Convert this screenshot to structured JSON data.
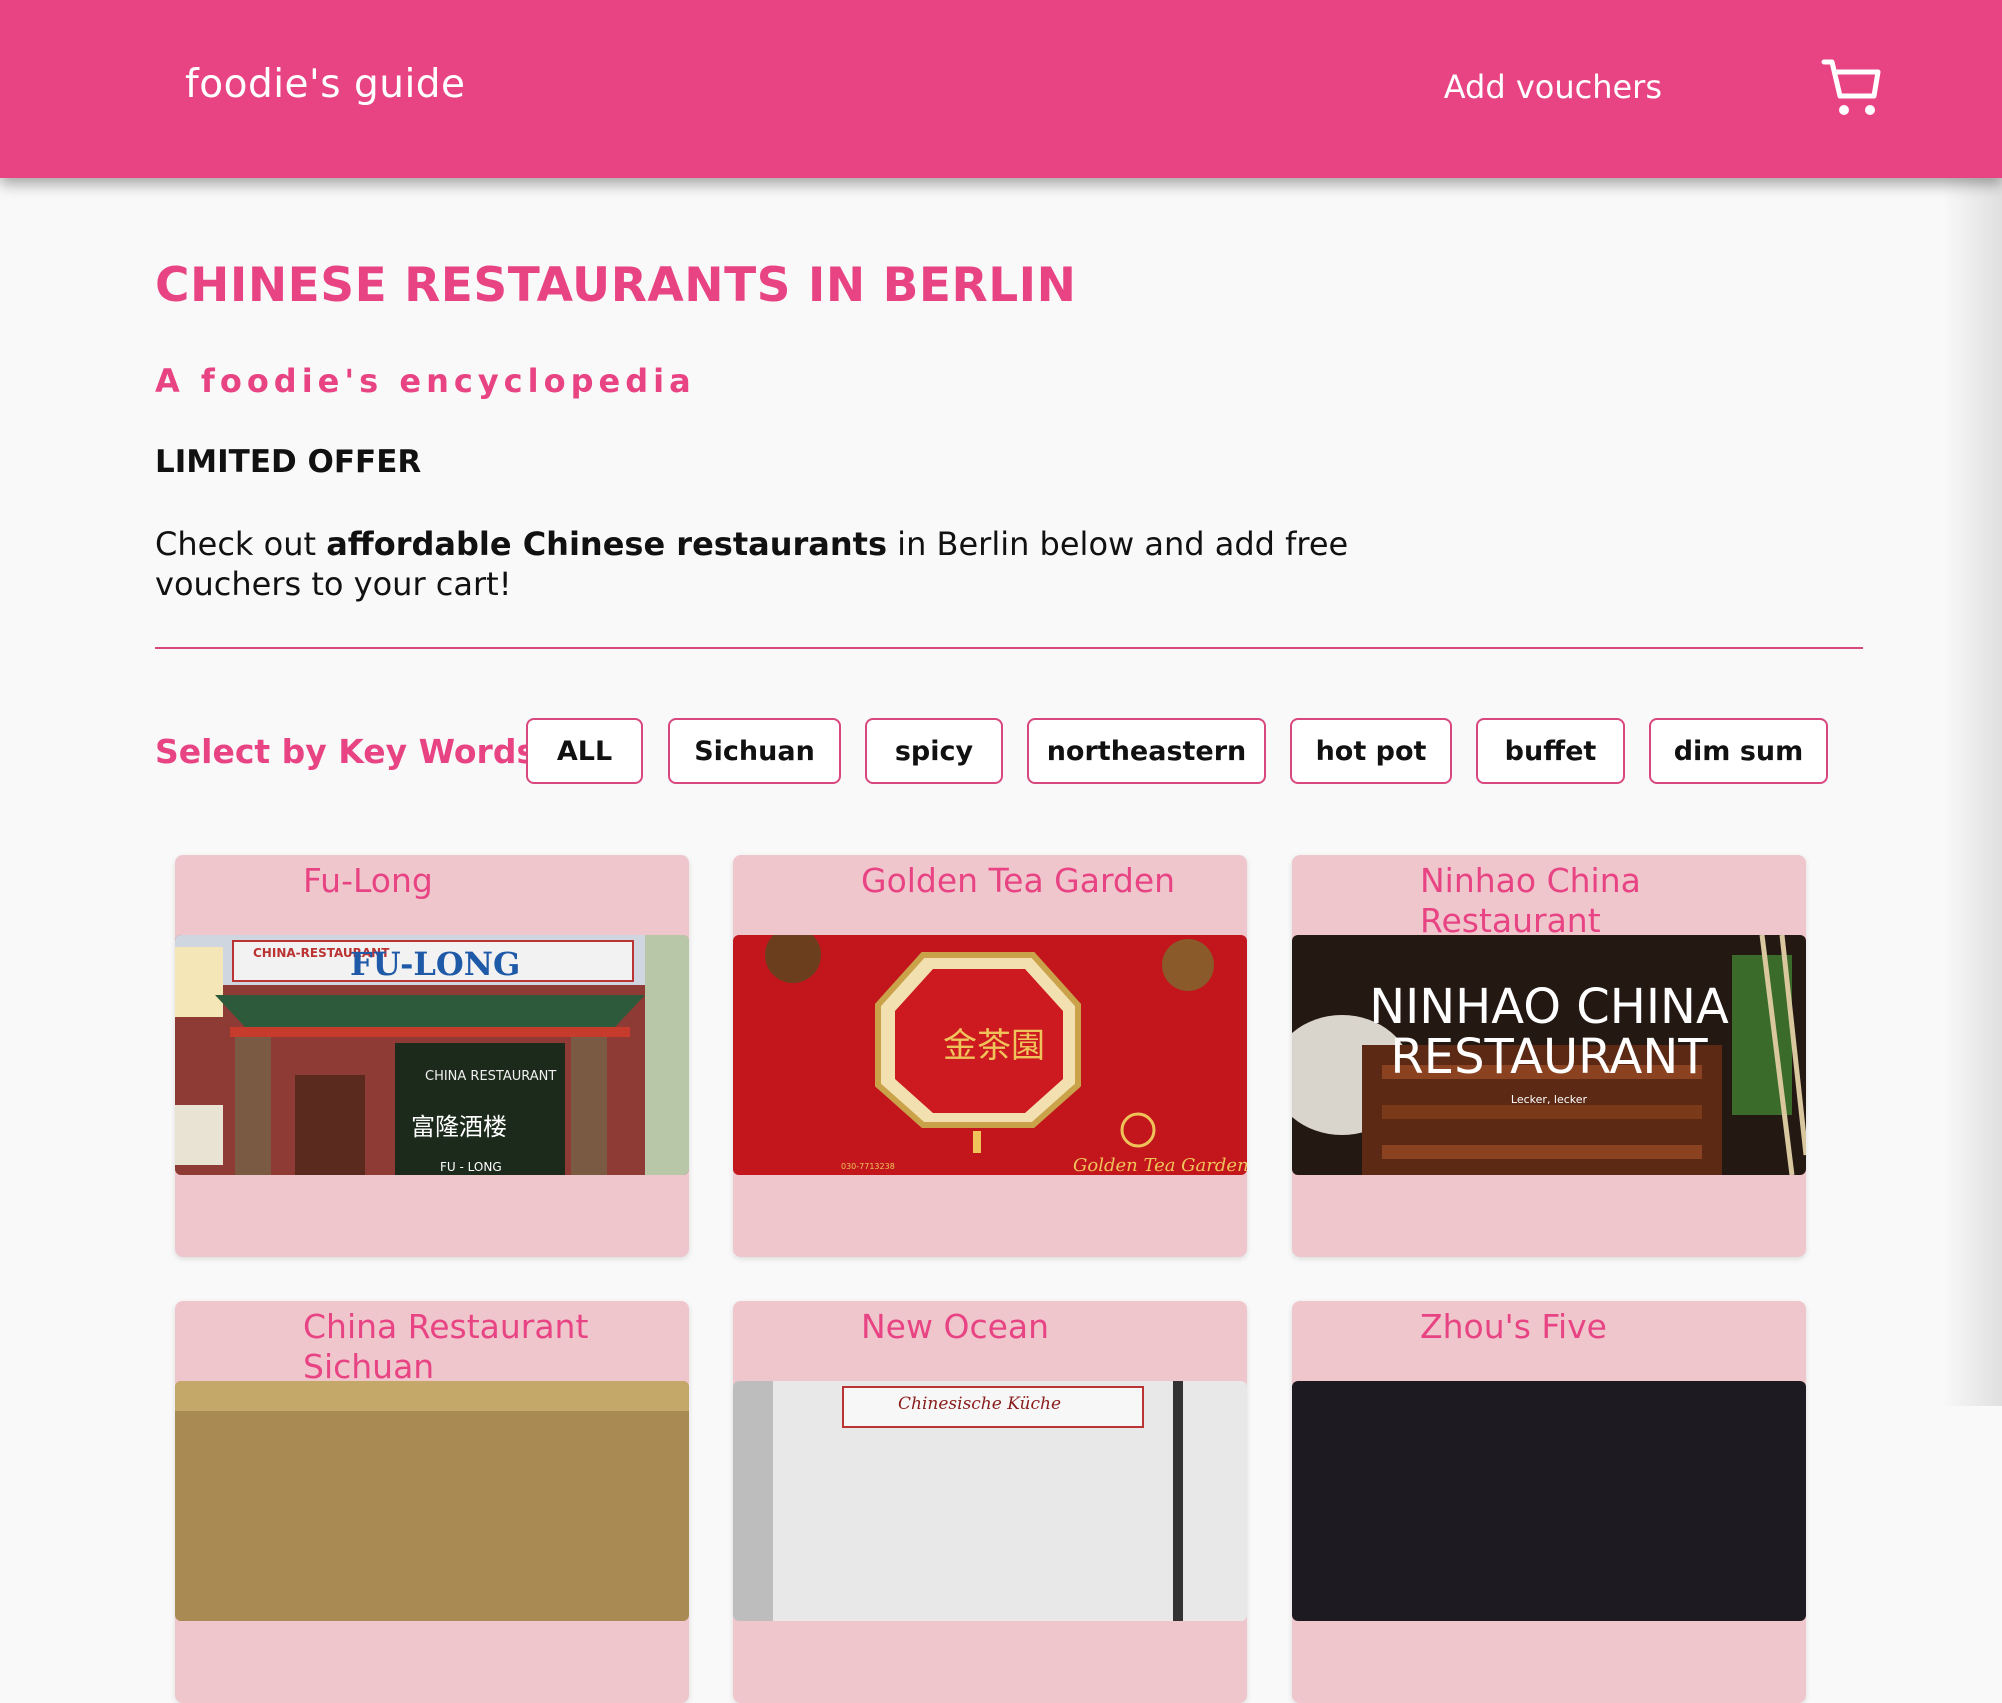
{
  "header": {
    "brand": "foodie's guide",
    "add_vouchers": "Add vouchers",
    "cart_icon": "shopping-cart-icon"
  },
  "main": {
    "title": "CHINESE RESTAURANTS IN BERLIN",
    "subtitle": "A foodie's encyclopedia",
    "offer_heading": "LIMITED OFFER",
    "description": {
      "before": "Check out ",
      "highlight": "affordable Chinese restaurants",
      "after": " in Berlin below and add free vouchers to your cart!"
    },
    "filter": {
      "label": "Select by Key Words:",
      "chips": [
        "ALL",
        "Sichuan",
        "spicy",
        "northeastern",
        "hot pot",
        "buffet",
        "dim sum"
      ]
    },
    "restaurants": [
      {
        "name": "Fu-Long",
        "sign_text": "FU-LONG",
        "sign_small": "CHINA-RESTAURANT",
        "window_text": "CHINA RESTAURANT",
        "chinese": "富隆酒楼",
        "bottom_text": "FU - LONG"
      },
      {
        "name": "Golden Tea Garden",
        "emblem": "金茶園",
        "footer_text": "Golden Tea Garden",
        "phone": "030-7713238"
      },
      {
        "name": "Ninhao China Restaurant",
        "banner_line1": "NINHAO CHINA",
        "banner_line2": "RESTAURANT",
        "tagline": "Lecker, lecker"
      },
      {
        "name": "China Restaurant Sichuan"
      },
      {
        "name": "New Ocean",
        "sign_text": "Chinesische Küche"
      },
      {
        "name": "Zhou's Five"
      }
    ]
  },
  "colors": {
    "accent": "#e84484",
    "card_bg": "#f0c6cd",
    "page_bg": "#f9f9f9"
  }
}
